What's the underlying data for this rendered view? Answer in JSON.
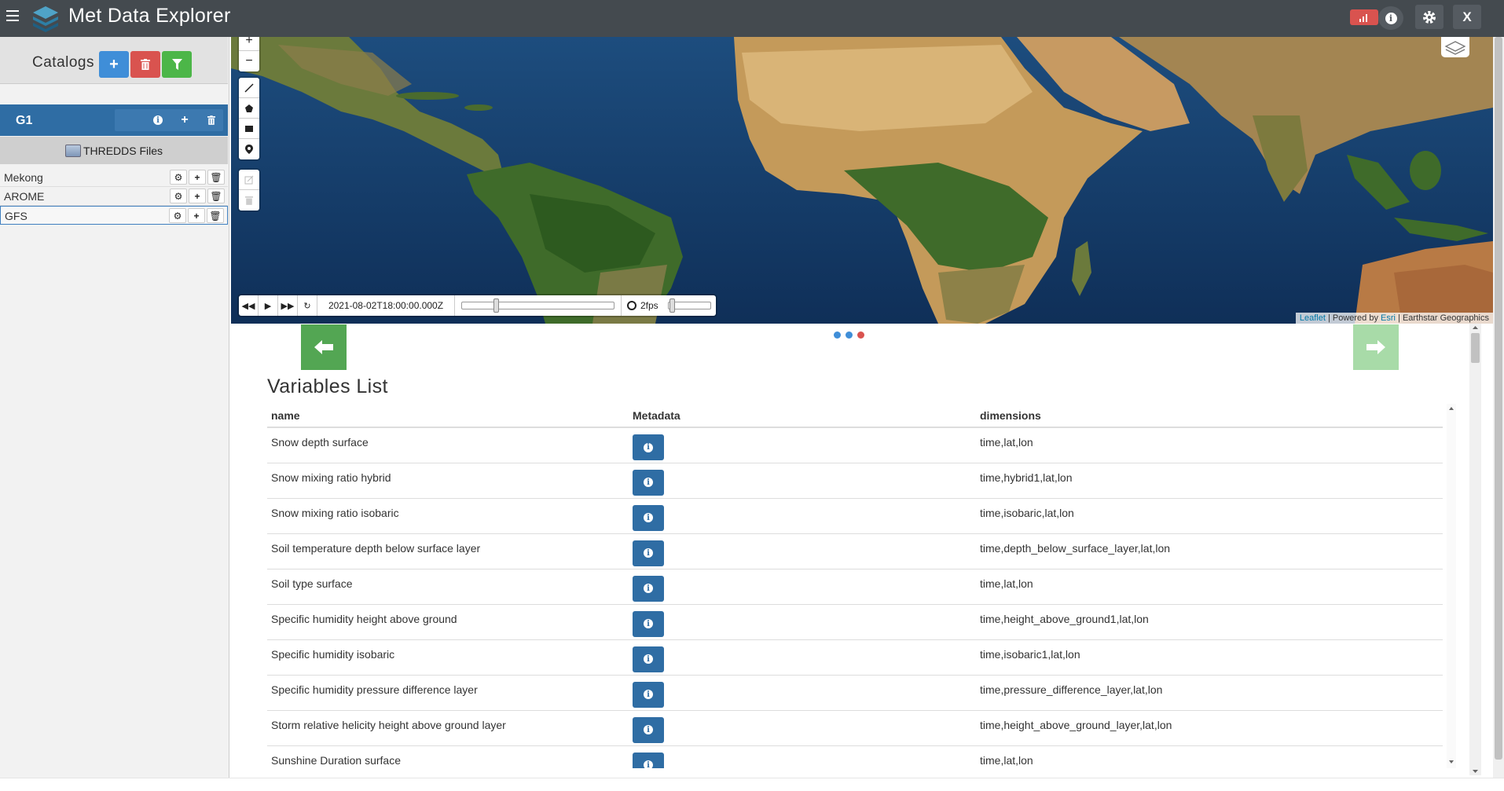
{
  "header": {
    "app_title": "Met Data Explorer",
    "close_label": "X"
  },
  "sidebar": {
    "catalogs_label": "Catalogs",
    "group": {
      "name": "G1"
    },
    "section_label": "THREDDS Files",
    "files": [
      {
        "name": "Mekong"
      },
      {
        "name": "AROME"
      },
      {
        "name": "GFS"
      }
    ]
  },
  "map": {
    "time_display": "2021-08-02T18:00:00.000Z",
    "fps_label": "2fps",
    "attribution": {
      "leaflet": "Leaflet",
      "powered_by": " | Powered by ",
      "esri": "Esri",
      "provider": " | Earthstar Geographics"
    }
  },
  "content": {
    "title": "Variables List",
    "columns": [
      "name",
      "Metadata",
      "dimensions"
    ],
    "rows": [
      {
        "name": "Snow depth surface",
        "dimensions": "time,lat,lon"
      },
      {
        "name": "Snow mixing ratio hybrid",
        "dimensions": "time,hybrid1,lat,lon"
      },
      {
        "name": "Snow mixing ratio isobaric",
        "dimensions": "time,isobaric,lat,lon"
      },
      {
        "name": "Soil temperature depth below surface layer",
        "dimensions": "time,depth_below_surface_layer,lat,lon"
      },
      {
        "name": "Soil type surface",
        "dimensions": "time,lat,lon"
      },
      {
        "name": "Specific humidity height above ground",
        "dimensions": "time,height_above_ground1,lat,lon"
      },
      {
        "name": "Specific humidity isobaric",
        "dimensions": "time,isobaric1,lat,lon"
      },
      {
        "name": "Specific humidity pressure difference layer",
        "dimensions": "time,pressure_difference_layer,lat,lon"
      },
      {
        "name": "Storm relative helicity height above ground layer",
        "dimensions": "time,height_above_ground_layer,lat,lon"
      },
      {
        "name": "Sunshine Duration surface",
        "dimensions": "time,lat,lon"
      }
    ]
  },
  "colors": {
    "header_bg": "#444a4f",
    "primary_blue": "#3f8ed8",
    "group_blue": "#2f6da4",
    "danger_red": "#d9534f",
    "success_green": "#4cb648"
  }
}
